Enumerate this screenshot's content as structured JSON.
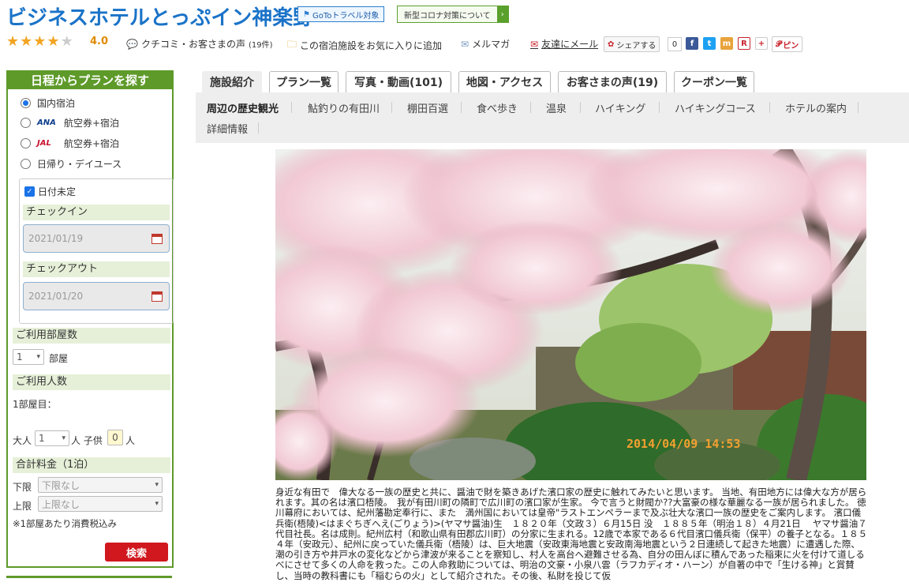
{
  "header": {
    "title": "ビジネスホテルとっぷイン神楽野",
    "goto_badge": "GoToトラベル対象",
    "covid_badge": "新型コロナ対策について",
    "rating": "4.0",
    "rating_stars": 4,
    "reviews_link": "クチコミ・お客さまの声",
    "reviews_count": "(19件)",
    "favorite_link": "この宿泊施設をお気に入りに追加",
    "magazine_link": "メルマガ",
    "mail_friend_link": "友達にメール",
    "share_label": "シェアする",
    "share_count": "0",
    "pin_label": "ピン"
  },
  "sidebar": {
    "title": "日程からプランを探す",
    "options": [
      "国内宿泊",
      "航空券+宿泊",
      "航空券+宿泊",
      "日帰り・デイユース"
    ],
    "airline_ana": "ANA",
    "airline_jal": "JAL",
    "date_undecided": "日付未定",
    "checkin_label": "チェックイン",
    "checkin_value": "2021/01/19",
    "checkout_label": "チェックアウト",
    "checkout_value": "2021/01/20",
    "rooms_label": "ご利用部屋数",
    "rooms_value": "1",
    "rooms_unit": "部屋",
    "people_label": "ご利用人数",
    "room1_label": "1部屋目：",
    "adult_label": "大人",
    "adult_value": "1",
    "adult_unit": "人 子供",
    "child_value": "0",
    "child_unit": "人",
    "price_label": "合計料金（1泊）",
    "min_label": "下限",
    "min_value": "下限なし",
    "max_label": "上限",
    "max_value": "上限なし",
    "tax_note": "※1部屋あたり消費税込み",
    "search_button": "検索"
  },
  "tabs": [
    "施設紹介",
    "プラン一覧",
    "写真・動画(101)",
    "地図・アクセス",
    "お客さまの声(19)",
    "クーポン一覧"
  ],
  "subnav": [
    "周辺の歴史観光",
    "鮎釣りの有田川",
    "棚田百選",
    "食べ歩き",
    "温泉",
    "ハイキング",
    "ハイキングコース",
    "ホテルの案内",
    "詳細情報"
  ],
  "photo": {
    "timestamp": "2014/04/09 14:53"
  },
  "description": "身近な有田で　偉大なる一族の歴史と共に、醤油で財を築きあげた濱口家の歴史に触れてみたいと思います。 当地、有田地方には偉大な方が居られます。其の名は濱口梧陵。　我が有田川町の隣町で広川町の濱口家が生家。 今で言うと財閥か??大富豪の様な華麗なる一族が居られました。 徳川幕府においては、紀州藩勘定奉行に、また　満州国においては皇帝\"ラストエンペラーまで及ぶ壮大な濱口一族の歴史をご案内します。 濱口儀兵衛(梧陵)<はまぐちぎへえ(ごりょう)>(ヤマサ醤油)生　１８２０年（文政３）６月15日 没　１８８５年（明治１８）４月21日　 ヤマサ醤油７代目社長。名は成則。紀州広村（和歌山県有田郡広川町）の分家に生まれる。12歳で本家である６代目濱口儀兵衛（保平）の養子となる。１８５４年（安政元）、紀州に戻っていた儀兵衛（梧陵）は、巨大地震（安政東海地震と安政南海地震という２日連続して起きた地震）に遭遇した際、潮の引き方や井戸水の変化などから津波が来ることを察知し、村人を高台へ避難させる為、自分の田んぼに積んであった稲束に火を付けて道しるべにさせて多くの人命を救った。この人命救助については、明治の文豪・小泉八雲（ラフカディオ・ハーン）が自著の中で「生ける神」と賞賛し、当時の教科書にも「稲むらの火」として紹介された。その後、私財を投じて仮"
}
